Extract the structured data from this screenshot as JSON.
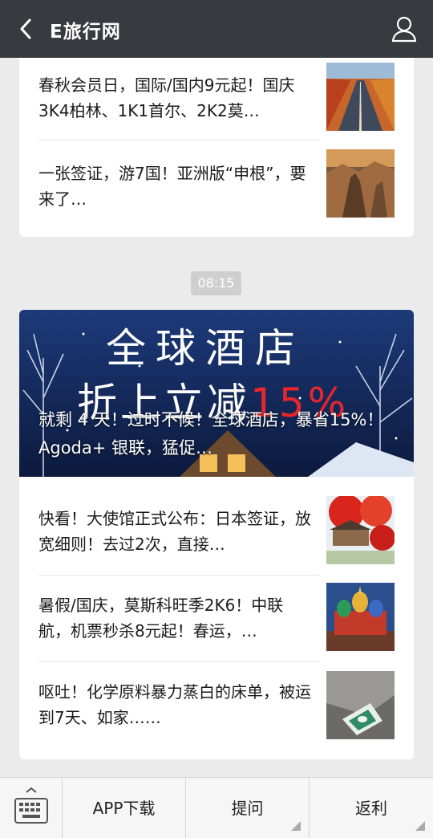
{
  "header": {
    "title": "E旅行网",
    "back_icon": "chevron-left-icon",
    "profile_icon": "person-icon",
    "background": "#393a3f"
  },
  "card1": {
    "items": [
      {
        "title": "春秋会员日，国际/国内9元起！国庆3K4柏林、1K1首尔、2K2莫…"
      },
      {
        "title": "一张签证，游7国！亚洲版“申根”，要来了…"
      }
    ]
  },
  "timestamp": "08:15",
  "card2": {
    "banner": {
      "image_text_line1": "全球酒店",
      "image_text_line2_prefix": "折上立减",
      "image_text_line2_highlight": "15%",
      "title": "就剩 4 天！过时不候！全球酒店，暴省15%！Agoda+ 银联，猛促…",
      "highlight_color": "#e8262d"
    },
    "items": [
      {
        "title": "快看！大使馆正式公布：日本签证，放宽细则！去过2次，直接…"
      },
      {
        "title": "暑假/国庆，莫斯科旺季2K6！中联航，机票秒杀8元起！春运，…"
      },
      {
        "title": "呕吐！化学原料暴力蒸白的床单，被运到7天、如家……"
      }
    ]
  },
  "bottom_menu": {
    "keyboard_icon": "keyboard-icon",
    "items": [
      {
        "label": "APP下载"
      },
      {
        "label": "提问"
      },
      {
        "label": "返利"
      }
    ]
  }
}
